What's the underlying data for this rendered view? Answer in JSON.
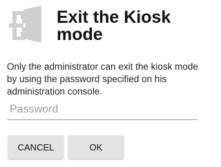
{
  "dialog": {
    "title": "Exit the Kiosk mode",
    "message": "Only the administrator can exit the kiosk mode by using the password specified on his administration console.",
    "password_placeholder": "Password",
    "cancel_label": "CANCEL",
    "ok_label": "OK",
    "icon": "exit-door-icon"
  },
  "colors": {
    "background": "#ffffff",
    "text": "#111111",
    "icon": "#c8c8c8",
    "button_background": "#e3e3e3",
    "input_underline": "#9b9b9b",
    "placeholder": "#9a9a9a"
  }
}
